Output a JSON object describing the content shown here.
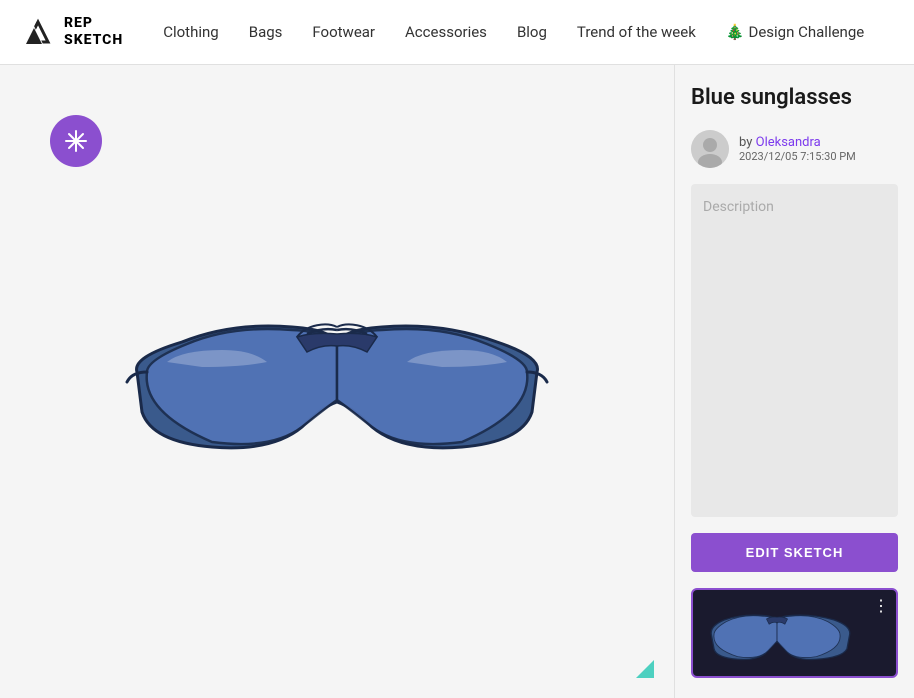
{
  "header": {
    "logo_line1": "REP",
    "logo_line2": "SKETCH",
    "nav_items": [
      {
        "label": "Clothing",
        "href": "#"
      },
      {
        "label": "Bags",
        "href": "#"
      },
      {
        "label": "Footwear",
        "href": "#"
      },
      {
        "label": "Accessories",
        "href": "#"
      },
      {
        "label": "Blog",
        "href": "#"
      },
      {
        "label": "Trend of the week",
        "href": "#"
      }
    ],
    "design_challenge_label": "Design Challenge",
    "design_challenge_icon": "🎄"
  },
  "canvas": {
    "plus_button_label": "+",
    "plus_aria": "Add element"
  },
  "right_panel": {
    "title": "Blue sunglasses",
    "by_label": "by",
    "author_name": "Oleksandra",
    "author_href": "#",
    "date": "2023/12/05 7:15:30 PM",
    "description_placeholder": "Description",
    "edit_button_label": "EDIT SKETCH",
    "thumbnail_menu_dots": "⋮"
  }
}
